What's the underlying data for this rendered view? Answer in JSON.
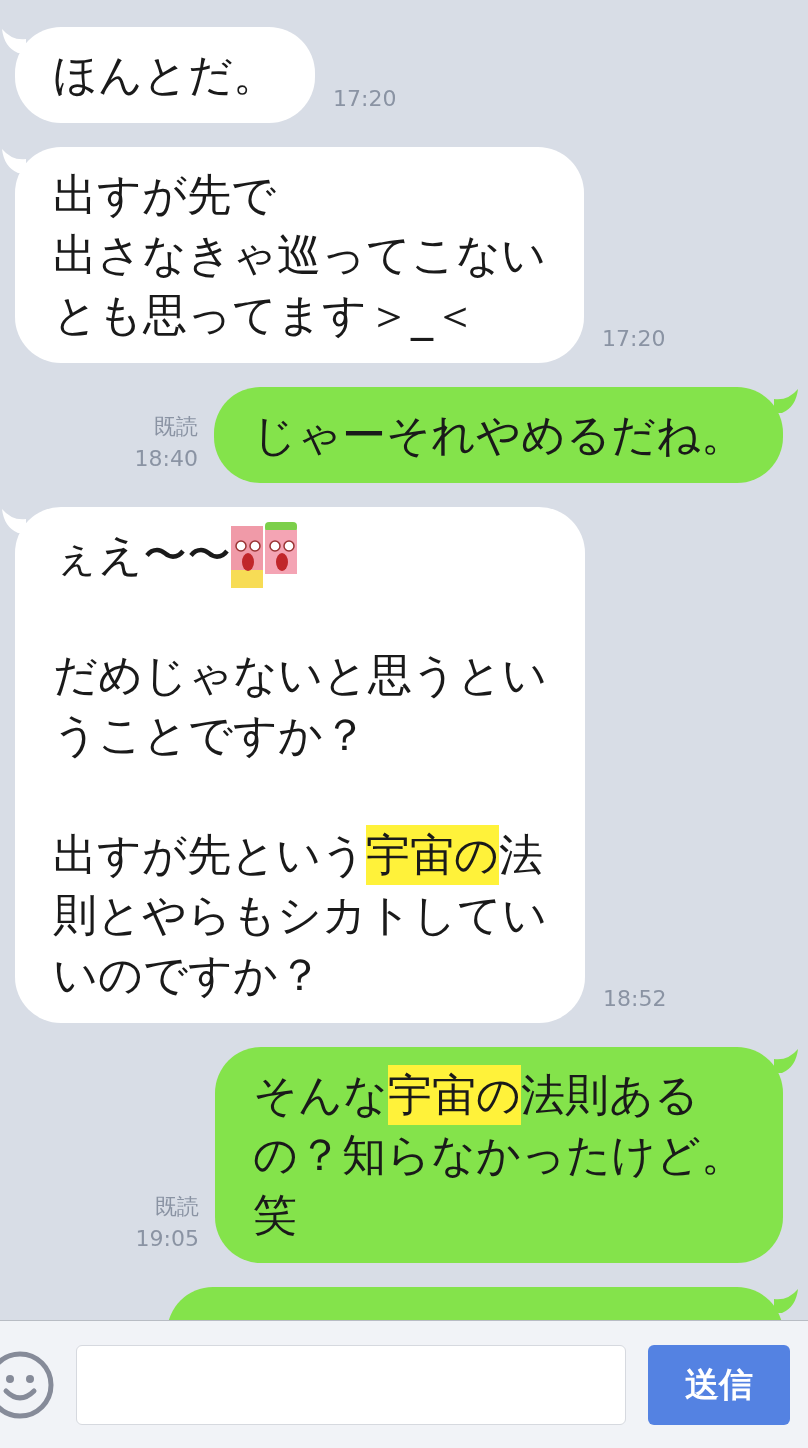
{
  "messages": [
    {
      "kind": "incoming",
      "time": "17:20",
      "lines": [
        [
          {
            "kind": "text",
            "text": "ほんとだ。",
            "highlighted": false
          }
        ]
      ]
    },
    {
      "kind": "incoming",
      "time": "17:20",
      "lines": [
        [
          {
            "kind": "text",
            "text": "出すが先で",
            "highlighted": false
          }
        ],
        [
          {
            "kind": "text",
            "text": "出さなきゃ巡ってこない",
            "highlighted": false
          }
        ],
        [
          {
            "kind": "text",
            "text": "とも思ってます＞_＜",
            "highlighted": false
          }
        ]
      ]
    },
    {
      "kind": "outgoing",
      "read": "既読",
      "time": "18:40",
      "lines": [
        [
          {
            "kind": "text",
            "text": "じゃーそれやめるだね。",
            "highlighted": false
          }
        ]
      ]
    },
    {
      "kind": "incoming",
      "time": "18:52",
      "lines": [
        [
          {
            "kind": "text",
            "text": "ぇえ〜〜",
            "highlighted": false
          },
          {
            "kind": "sticker"
          }
        ],
        [
          {
            "kind": "blank"
          }
        ],
        [
          {
            "kind": "text",
            "text": "だめじゃないと思うとい",
            "highlighted": false
          }
        ],
        [
          {
            "kind": "text",
            "text": "うことですか？",
            "highlighted": false
          }
        ],
        [
          {
            "kind": "blank"
          }
        ],
        [
          {
            "kind": "text",
            "text": "出すが先という",
            "highlighted": false
          },
          {
            "kind": "text",
            "text": "宇宙の",
            "highlighted": true
          },
          {
            "kind": "text",
            "text": "法",
            "highlighted": false
          }
        ],
        [
          {
            "kind": "text",
            "text": "則とやらもシカトしてい",
            "highlighted": false
          }
        ],
        [
          {
            "kind": "text",
            "text": "いのですか？",
            "highlighted": false
          }
        ]
      ]
    },
    {
      "kind": "outgoing",
      "read": "既読",
      "time": "19:05",
      "lines": [
        [
          {
            "kind": "text",
            "text": "そんな",
            "highlighted": false
          },
          {
            "kind": "text",
            "text": "宇宙の",
            "highlighted": true
          },
          {
            "kind": "text",
            "text": "法則ある",
            "highlighted": false
          }
        ],
        [
          {
            "kind": "text",
            "text": "の？知らなかったけど。",
            "highlighted": false
          }
        ],
        [
          {
            "kind": "text",
            "text": "笑",
            "highlighted": false
          }
        ]
      ]
    },
    {
      "kind": "cut_off"
    }
  ],
  "composer": {
    "send_label": "送信"
  }
}
